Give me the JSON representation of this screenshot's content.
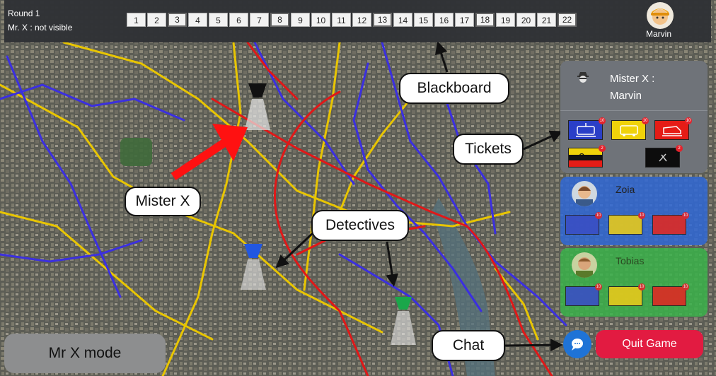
{
  "header": {
    "round": "Round 1",
    "mrx_status": "Mr. X : not visible",
    "rounds": [
      "1",
      "2",
      "3",
      "4",
      "5",
      "6",
      "7",
      "8",
      "9",
      "10",
      "11",
      "12",
      "13",
      "14",
      "15",
      "16",
      "17",
      "18",
      "19",
      "20",
      "21",
      "22"
    ],
    "reveal_rounds": [
      "3",
      "8",
      "13",
      "18",
      "22"
    ],
    "username": "Marvin"
  },
  "mrx_panel": {
    "line1": "Mister X :",
    "line2": "Marvin",
    "tickets": [
      {
        "type": "tram",
        "color": "#2a3fc7",
        "count": "10"
      },
      {
        "type": "bus",
        "color": "#f0d20a",
        "count": "10"
      },
      {
        "type": "train",
        "color": "#e51c16",
        "count": "10"
      },
      {
        "type": "double",
        "label": "2x",
        "count": "2"
      },
      {
        "type": "black",
        "count": "2"
      }
    ]
  },
  "detectives": [
    {
      "name": "Zoia",
      "color": "#2f67d6",
      "counts": [
        "10",
        "10",
        "10"
      ]
    },
    {
      "name": "Tobias",
      "color": "#39b24a",
      "counts": [
        "10",
        "10",
        "10"
      ]
    }
  ],
  "callouts": {
    "blackboard": "Blackboard",
    "tickets": "Tickets",
    "mister_x": "Mister X",
    "detectives": "Detectives",
    "chat": "Chat"
  },
  "buttons": {
    "mrx_mode": "Mr X mode",
    "quit": "Quit Game"
  },
  "colors": {
    "tram": "#3b2fe0",
    "bus": "#e8c500",
    "train": "#e01818",
    "quit": "#e21b41",
    "chat": "#1f73d6",
    "arrow_red": "#ff1111"
  }
}
